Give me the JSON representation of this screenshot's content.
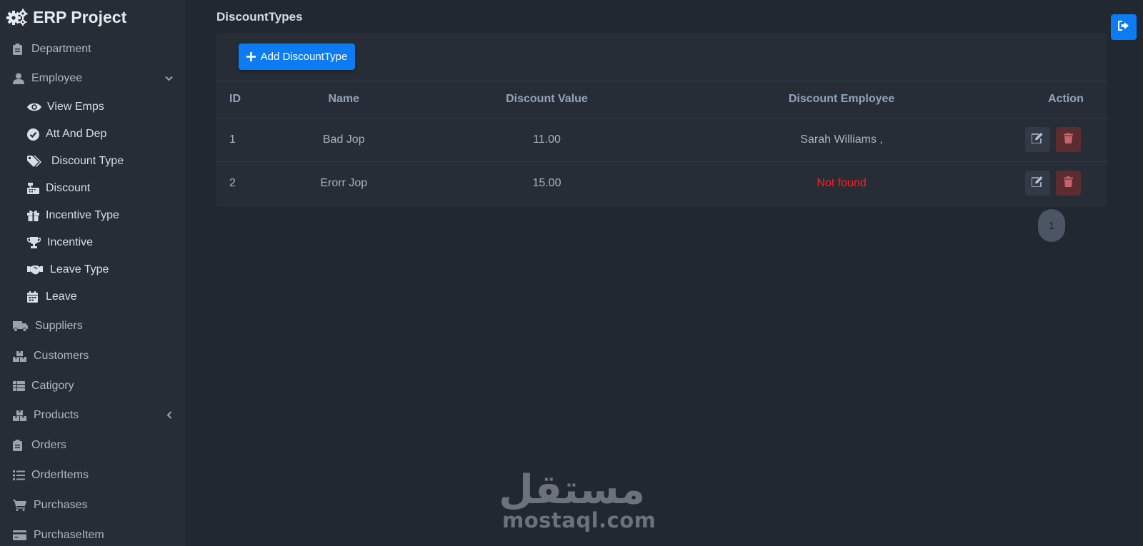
{
  "app": {
    "title": "ERP Project"
  },
  "sidebar": {
    "items": [
      {
        "label": "Department",
        "icon": "clipboard-icon"
      },
      {
        "label": "Employee",
        "icon": "user-icon"
      },
      {
        "label": "View Emps",
        "icon": "eye-icon"
      },
      {
        "label": "Att And Dep",
        "icon": "check-circle-icon"
      },
      {
        "label": "Discount Type",
        "icon": "tags-icon"
      },
      {
        "label": "Discount",
        "icon": "cash-register-icon"
      },
      {
        "label": "Incentive Type",
        "icon": "gift-icon"
      },
      {
        "label": "Incentive",
        "icon": "trophy-icon"
      },
      {
        "label": "Leave Type",
        "icon": "handshake-icon"
      },
      {
        "label": "Leave",
        "icon": "calendar-icon"
      },
      {
        "label": "Suppliers",
        "icon": "truck-icon"
      },
      {
        "label": "Customers",
        "icon": "boxes-icon"
      },
      {
        "label": "Catigory",
        "icon": "table-list-icon"
      },
      {
        "label": "Products",
        "icon": "boxes-icon"
      },
      {
        "label": "Orders",
        "icon": "clipboard-icon"
      },
      {
        "label": "OrderItems",
        "icon": "list-icon"
      },
      {
        "label": "Purchases",
        "icon": "cart-icon"
      },
      {
        "label": "PurchaseItem",
        "icon": "credit-card-icon"
      }
    ]
  },
  "main": {
    "title": "DiscountTypes",
    "add_button": "Add DiscountType",
    "table": {
      "headers": [
        "ID",
        "Name",
        "Discount Value",
        "Discount Employee",
        "Action"
      ],
      "rows": [
        {
          "id": "1",
          "name": "Bad Jop",
          "value": "11.00",
          "employee": "Sarah Williams ,"
        },
        {
          "id": "2",
          "name": "Erorr Jop",
          "value": "15.00",
          "employee": "Not found"
        }
      ]
    },
    "pagination": {
      "current": "1"
    }
  },
  "watermark": {
    "arabic": "مستقل",
    "latin": "mostaql.com"
  },
  "colors": {
    "accent": "#0d7cf2",
    "danger": "#ff1e1e",
    "background": "#222831",
    "sidebar": "#262d37"
  }
}
